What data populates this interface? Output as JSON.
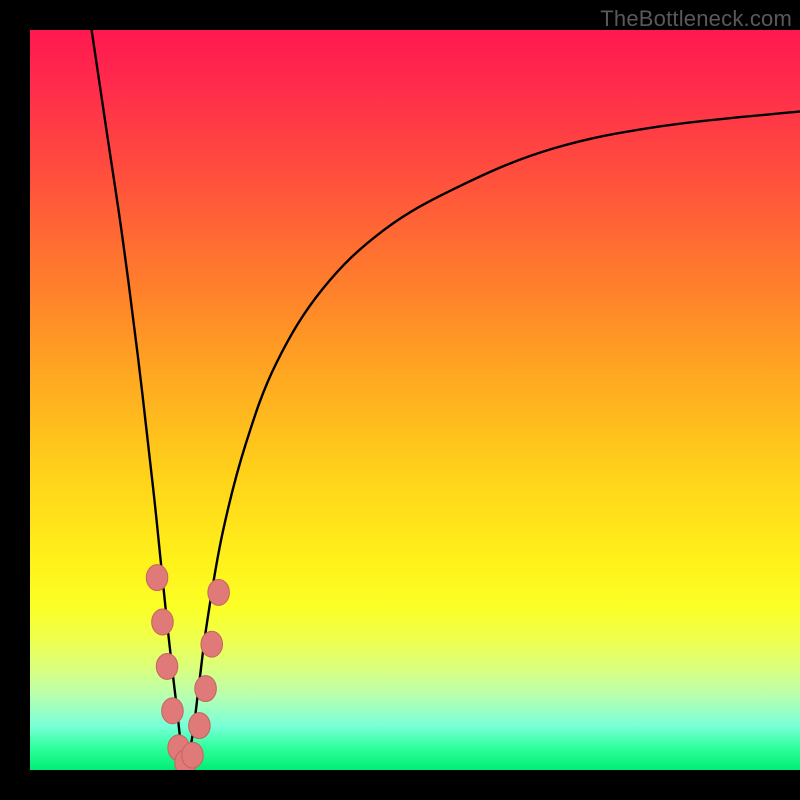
{
  "watermark": "TheBottleneck.com",
  "colors": {
    "curve_stroke": "#000000",
    "marker_fill": "#e07a78",
    "marker_stroke": "#c46360",
    "frame": "#000000"
  },
  "chart_data": {
    "type": "line",
    "title": "",
    "xlabel": "",
    "ylabel": "",
    "xlim": [
      0,
      100
    ],
    "ylim": [
      0,
      100
    ],
    "grid": false,
    "legend_position": "none",
    "series": [
      {
        "name": "bottleneck-curve",
        "notch_x": 20,
        "x": [
          8,
          10,
          12,
          14,
          16,
          17,
          18,
          19,
          20,
          21,
          22,
          23,
          25,
          28,
          32,
          38,
          46,
          56,
          68,
          82,
          100
        ],
        "y": [
          100,
          86,
          72,
          56,
          38,
          28,
          18,
          9,
          1,
          4,
          12,
          20,
          32,
          44,
          55,
          65,
          73,
          79,
          84,
          87,
          89
        ]
      }
    ],
    "markers": {
      "name": "highlighted-points",
      "points": [
        {
          "x": 16.5,
          "y": 26
        },
        {
          "x": 17.2,
          "y": 20
        },
        {
          "x": 17.8,
          "y": 14
        },
        {
          "x": 18.5,
          "y": 8
        },
        {
          "x": 19.3,
          "y": 3
        },
        {
          "x": 20.2,
          "y": 1
        },
        {
          "x": 21.1,
          "y": 2
        },
        {
          "x": 22.0,
          "y": 6
        },
        {
          "x": 22.8,
          "y": 11
        },
        {
          "x": 23.6,
          "y": 17
        },
        {
          "x": 24.5,
          "y": 24
        }
      ],
      "radius_domain": 1.4
    }
  }
}
